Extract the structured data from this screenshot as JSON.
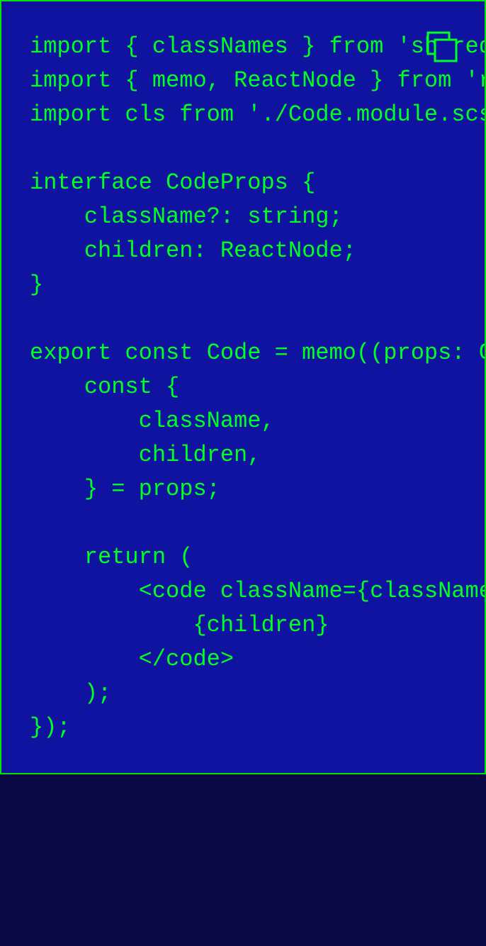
{
  "code_block": {
    "language": "tsx",
    "code": "import { classNames } from 'shared/lib/classNames';\nimport { memo, ReactNode } from 'react';\nimport cls from './Code.module.scss';\n\ninterface CodeProps {\n    className?: string;\n    children: ReactNode;\n}\n\nexport const Code = memo((props: CodeProps) => {\n    const {\n        className,\n        children,\n    } = props;\n\n    return (\n        <code className={classNames(cls.Code, {}, [className])}>\n            {children}\n        </code>\n    );\n});",
    "copy_icon": "copy-icon"
  },
  "colors": {
    "page_background": "#0a0745",
    "code_background": "#0f13a0",
    "code_text": "#00ff22",
    "border": "#00e600"
  }
}
